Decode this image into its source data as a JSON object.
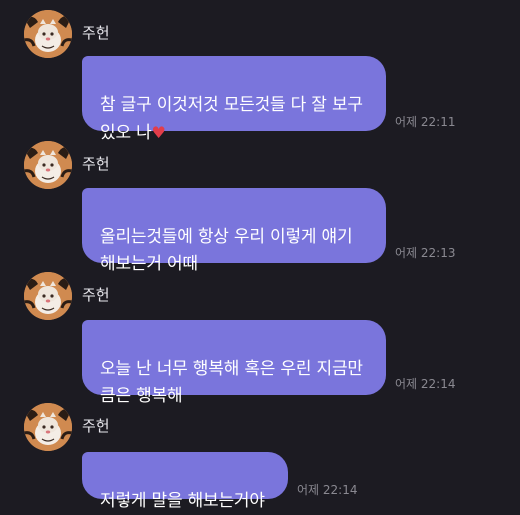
{
  "chat": {
    "messages": [
      {
        "sender": "주헌",
        "text": "참 글구 이것저것 모든것들 다 잘 보구\n있오 나",
        "emoji": "♥",
        "time": "어제 22:11"
      },
      {
        "sender": "주헌",
        "text": "올리는것들에 항상 우리 이렇게 얘기\n해보는거 어때",
        "time": "어제 22:13"
      },
      {
        "sender": "주헌",
        "text": "오늘 난 너무 행복해 혹은 우린 지금만\n큼은 행복해",
        "time": "어제 22:14"
      },
      {
        "sender": "주헌",
        "text": "저렇게 말을 해보는거야",
        "time": "어제 22:14"
      }
    ]
  },
  "colors": {
    "background": "#1c1b22",
    "bubble": "#7a75dc",
    "timestamp": "#8a8991",
    "heart": "#e23d4a"
  },
  "icons": {
    "avatar": "tiger-character-avatar",
    "emoji": "red-heart"
  }
}
